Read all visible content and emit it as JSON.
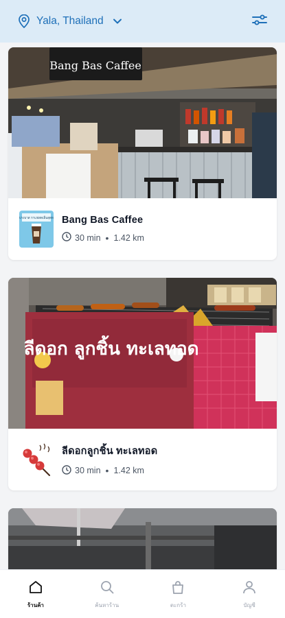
{
  "header": {
    "location": "Yala, Thailand",
    "accent": "#1d6fb8",
    "background": "#dcebf7",
    "location_icon": "map-pin-icon",
    "dropdown_icon": "chevron-down-icon",
    "filter_icon": "sliders-icon"
  },
  "feed": {
    "items": [
      {
        "name": "Bang Bas Caffee",
        "sign_text": "Bang Bas Caffee",
        "thumb_text": "อยู่บางบาส กาแฟสดเย็นสุดหอม",
        "time": "30 min",
        "distance": "1.42 km",
        "time_icon": "clock-icon"
      },
      {
        "name": "ลีดอกลูกชิ้น ทะเลทอด",
        "sign_text": "ลีดอก ลูกชิ้น ทะเลทอด",
        "time": "30 min",
        "distance": "1.42 km",
        "time_icon": "clock-icon"
      }
    ]
  },
  "tabbar": {
    "tabs": [
      {
        "label": "ร้านค้า",
        "icon": "home-icon",
        "active": true
      },
      {
        "label": "ค้นหาร้าน",
        "icon": "search-icon",
        "active": false
      },
      {
        "label": "ตะกร้า",
        "icon": "bag-icon",
        "active": false
      },
      {
        "label": "บัญชี",
        "icon": "user-icon",
        "active": false
      }
    ]
  }
}
